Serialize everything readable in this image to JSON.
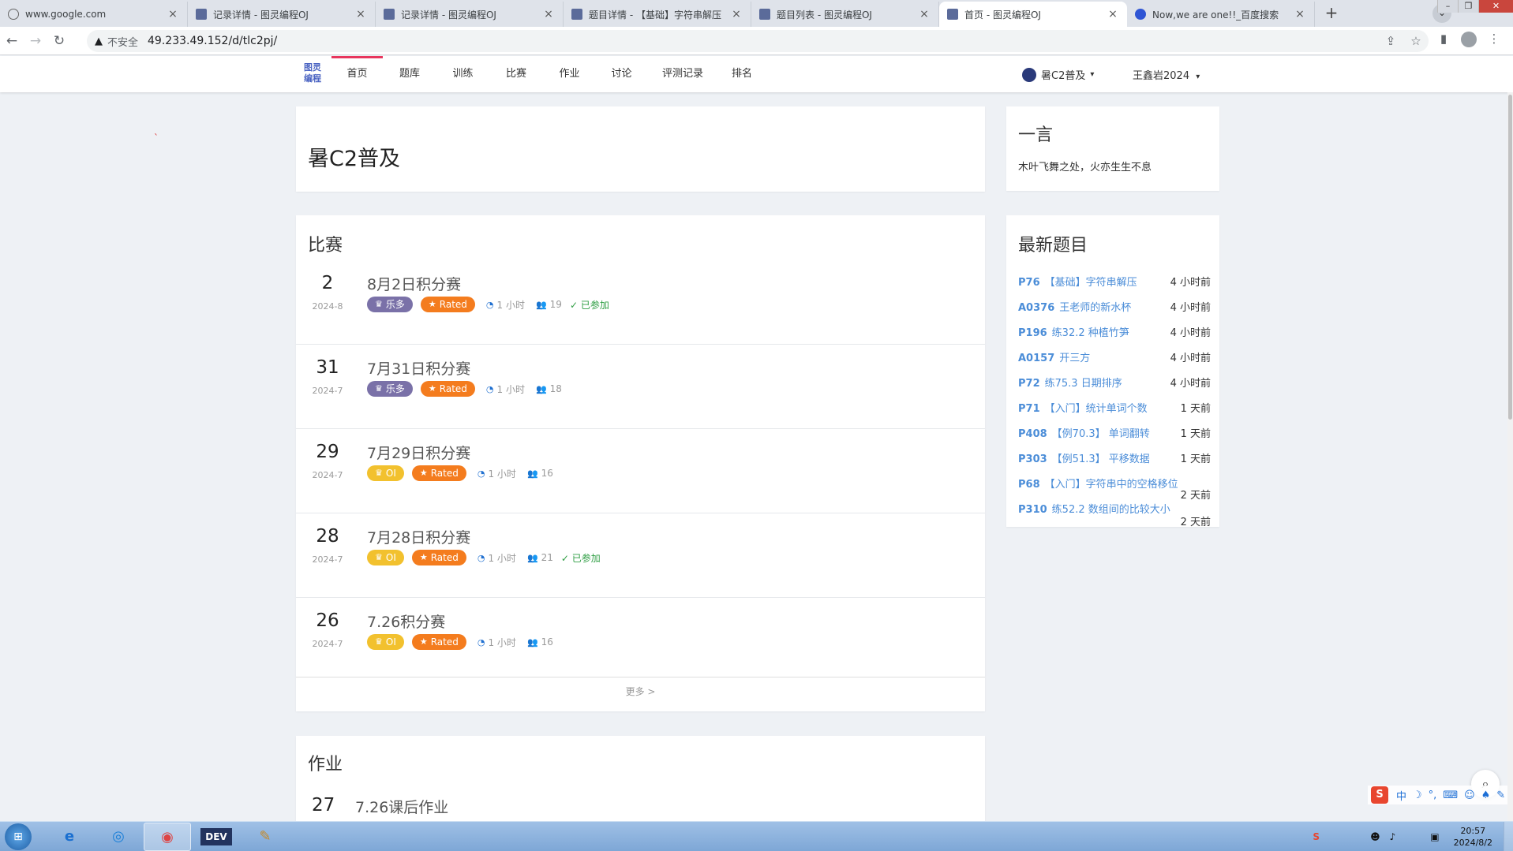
{
  "browser": {
    "tabs": [
      {
        "title": "www.google.com",
        "icon": "google"
      },
      {
        "title": "记录详情 - 图灵编程OJ",
        "icon": "oj"
      },
      {
        "title": "记录详情 - 图灵编程OJ",
        "icon": "oj"
      },
      {
        "title": "题目详情 - 【基础】字符串解压",
        "icon": "oj"
      },
      {
        "title": "题目列表 - 图灵编程OJ",
        "icon": "oj"
      },
      {
        "title": "首页 - 图灵编程OJ",
        "icon": "oj",
        "active": true
      },
      {
        "title": "Now,we are one!!_百度搜索",
        "icon": "baidu"
      }
    ],
    "close_glyph": "×",
    "new_tab_glyph": "+",
    "insecure_label": "不安全",
    "url": "49.233.49.152/d/tlc2pj/",
    "warn_glyph": "▲"
  },
  "site": {
    "logo_text": "图灵编程",
    "nav": [
      "首页",
      "题库",
      "训练",
      "比赛",
      "作业",
      "讨论",
      "评测记录",
      "排名"
    ],
    "domain_label": "暑C2普及",
    "user_label": "王鑫岩2024",
    "caret": "▾"
  },
  "main": {
    "domain_title": "暑C2普及",
    "contests_title": "比赛",
    "contests": [
      {
        "day": "2",
        "month": "2024-8",
        "title": "8月2日积分赛",
        "rule": "乐多",
        "rule_color": "purple",
        "rated": "Rated",
        "duration": "1 小时",
        "attendees": "19",
        "joined": "已参加"
      },
      {
        "day": "31",
        "month": "2024-7",
        "title": "7月31日积分赛",
        "rule": "乐多",
        "rule_color": "purple",
        "rated": "Rated",
        "duration": "1 小时",
        "attendees": "18",
        "joined": ""
      },
      {
        "day": "29",
        "month": "2024-7",
        "title": "7月29日积分赛",
        "rule": "OI",
        "rule_color": "yellow",
        "rated": "Rated",
        "duration": "1 小时",
        "attendees": "16",
        "joined": ""
      },
      {
        "day": "28",
        "month": "2024-7",
        "title": "7月28日积分赛",
        "rule": "OI",
        "rule_color": "yellow",
        "rated": "Rated",
        "duration": "1 小时",
        "attendees": "21",
        "joined": "已参加"
      },
      {
        "day": "26",
        "month": "2024-7",
        "title": "7.26积分赛",
        "rule": "OI",
        "rule_color": "yellow",
        "rated": "Rated",
        "duration": "1 小时",
        "attendees": "16",
        "joined": ""
      }
    ],
    "more_label": "更多 >",
    "homework_title": "作业",
    "homework": {
      "day": "27",
      "title": "7.26课后作业"
    }
  },
  "sidebar": {
    "hitokoto_title": "一言",
    "hitokoto_text": "木叶飞舞之处，火亦生生不息",
    "latest_title": "最新题目",
    "problems": [
      {
        "pid": "P76",
        "name": "【基础】字符串解压",
        "time": "4 小时前"
      },
      {
        "pid": "A0376",
        "name": "王老师的新水杯",
        "time": "4 小时前"
      },
      {
        "pid": "P196",
        "name": "练32.2 种植竹笋",
        "time": "4 小时前"
      },
      {
        "pid": "A0157",
        "name": "开三方",
        "time": "4 小时前"
      },
      {
        "pid": "P72",
        "name": "练75.3 日期排序",
        "time": "4 小时前"
      },
      {
        "pid": "P71",
        "name": "【入门】统计单词个数",
        "time": "1 天前"
      },
      {
        "pid": "P408",
        "name": "【例70.3】 单词翻转",
        "time": "1 天前"
      },
      {
        "pid": "P303",
        "name": "【例51.3】 平移数据",
        "time": "1 天前"
      },
      {
        "pid": "P68",
        "name": "【入门】字符串中的空格移位",
        "time": "2 天前"
      },
      {
        "pid": "P310",
        "name": "练52.2 数组间的比较大小",
        "time": "2 天前"
      }
    ]
  },
  "ime": {
    "logo": "S",
    "mode": "中"
  },
  "taskbar": {
    "clock_time": "20:57",
    "clock_date": "2024/8/2",
    "apps": [
      "start",
      "ie",
      "qq-browser",
      "chrome",
      "dev-cpp",
      "paint"
    ]
  }
}
